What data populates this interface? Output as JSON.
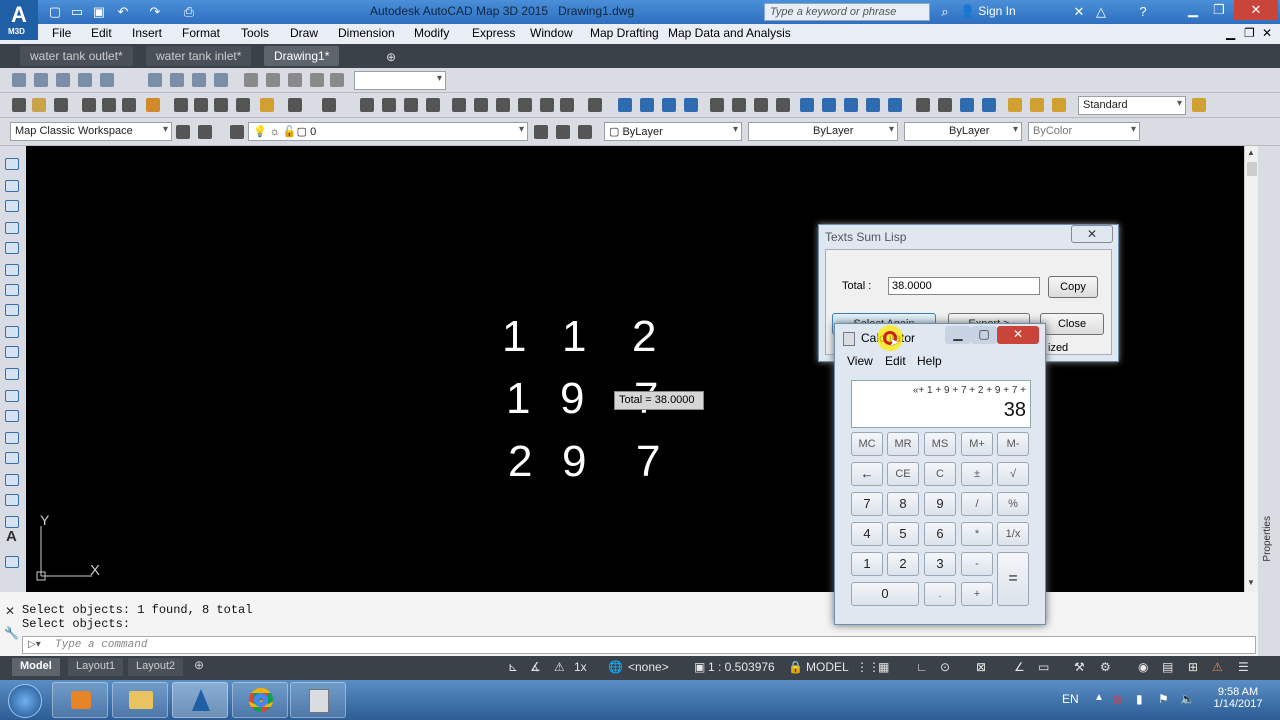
{
  "title_bar": {
    "app_title": "Autodesk AutoCAD Map 3D 2015",
    "doc_name": "Drawing1.dwg",
    "logo_text": "A",
    "logo_sub": "M3D",
    "search_placeholder": "Type a keyword or phrase",
    "sign_in": "Sign In"
  },
  "menu": [
    "File",
    "Edit",
    "Insert",
    "Format",
    "Tools",
    "Draw",
    "Dimension",
    "Modify",
    "Express",
    "Window",
    "Map Drafting",
    "Map Data and Analysis"
  ],
  "file_tabs": [
    "water tank outlet*",
    "water tank inlet*",
    "Drawing1*"
  ],
  "toolbar2": {
    "text_style": "Standard"
  },
  "toolbar3": {
    "workspace": "Map Classic Workspace",
    "layer": "0",
    "color": "ByLayer",
    "linetype": "ByLayer",
    "lineweight": "ByLayer",
    "plotstyle": "ByColor"
  },
  "canvas_numbers": {
    "row1": [
      "1",
      "1",
      "2"
    ],
    "row2": [
      "1",
      "9",
      "7"
    ],
    "row3": [
      "2",
      "9",
      "7"
    ]
  },
  "ucs": {
    "x": "X",
    "y": "Y"
  },
  "tooltip": "Total = 38.0000",
  "command": {
    "history": [
      "Select objects: 1 found, 8 total",
      "Select objects:"
    ],
    "placeholder": "Type a command"
  },
  "layout_tabs": [
    "Model",
    "Layout1",
    "Layout2"
  ],
  "status": {
    "scale_mult": "1x",
    "coord_sys": "<none>",
    "annotation_scale": "1 : 0.503976",
    "mode": "MODEL"
  },
  "right_panel_label": "Properties",
  "textsum_dialog": {
    "title": "Texts Sum Lisp",
    "total_label": "Total :",
    "total_value": "38.0000",
    "copy_label": "Copy",
    "select_label": "Select Again",
    "export_label": "Export >",
    "close_label": "Close",
    "partial_text": "ized"
  },
  "calculator": {
    "title": "Calculator",
    "menu": [
      "View",
      "Edit",
      "Help"
    ],
    "expression": "«+ 1 + 9 + 7 + 2 + 9 + 7 +",
    "display": "38",
    "keys": [
      [
        "MC",
        "MR",
        "MS",
        "M+",
        "M-"
      ],
      [
        "←",
        "CE",
        "C",
        "±",
        "√"
      ],
      [
        "7",
        "8",
        "9",
        "/",
        "%"
      ],
      [
        "4",
        "5",
        "6",
        "*",
        "1/x"
      ],
      [
        "1",
        "2",
        "3",
        "-"
      ],
      [
        "0",
        ".",
        "+"
      ]
    ],
    "equals": "="
  },
  "taskbar": {
    "lang": "EN",
    "time": "9:58 AM",
    "date": "1/14/2017"
  }
}
